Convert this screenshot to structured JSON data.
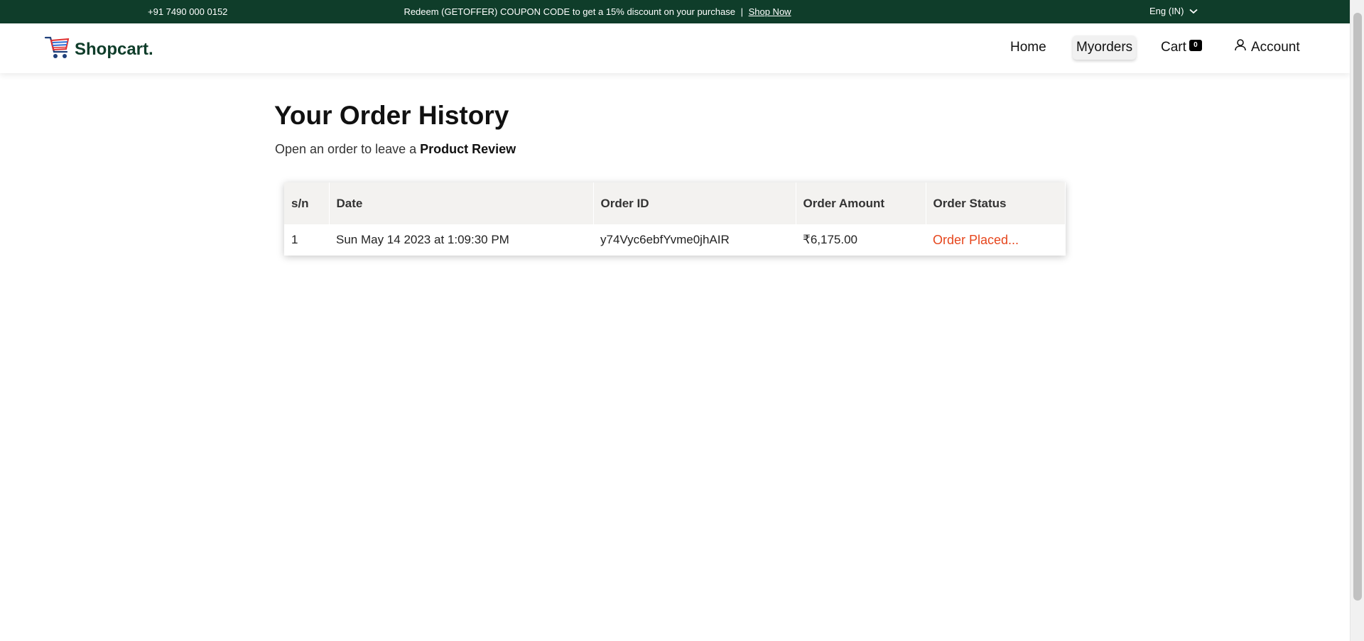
{
  "topbar": {
    "phone": "+91 7490 000 0152",
    "promo_text": "Redeem (GETOFFER) COUPON CODE to get a 15% discount on your purchase",
    "separator": "|",
    "shop_now": " Shop Now",
    "language": "Eng (IN)",
    "background": "#0f3d2a"
  },
  "header": {
    "logo_text": "Shopcart.",
    "nav": {
      "home": "Home",
      "orders": "Myorders",
      "cart": "Cart",
      "cart_count": "0",
      "account": "Account"
    }
  },
  "main": {
    "title": "Your Order History",
    "subtitle_prefix": "Open an order to leave a ",
    "subtitle_strong": "Product Review",
    "table": {
      "headers": [
        "s/n",
        "Date",
        "Order ID",
        "Order Amount",
        "Order Status"
      ],
      "rows": [
        {
          "sn": "1",
          "date": "Sun May 14 2023 at 1:09:30 PM",
          "order_id": "y74Vyc6ebfYvme0jhAIR",
          "amount": "₹6,175.00",
          "status": "Order Placed..."
        }
      ]
    }
  },
  "colors": {
    "accent_green": "#0f3d2a",
    "status_orange": "#e6461d"
  }
}
